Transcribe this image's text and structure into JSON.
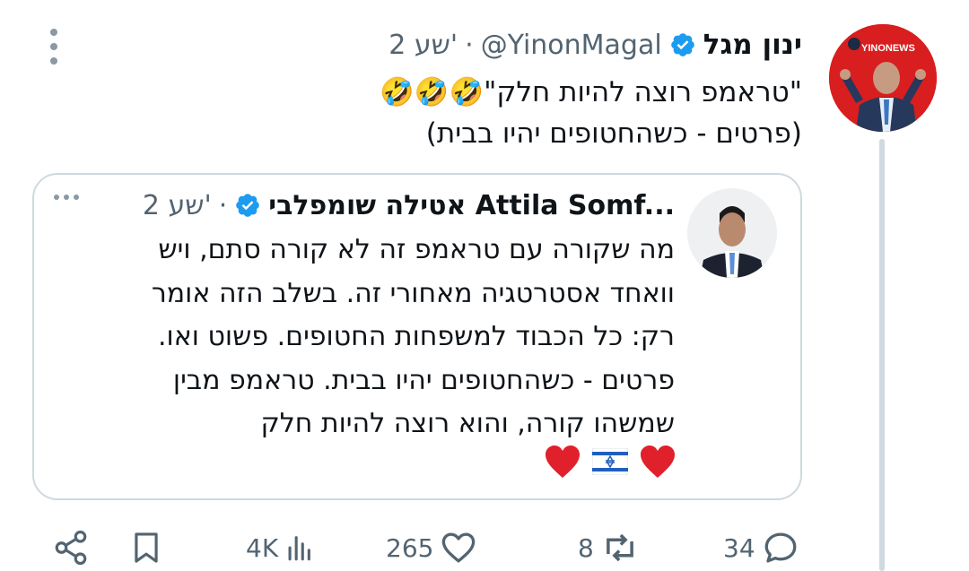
{
  "post": {
    "author_name": "ינון מגל",
    "handle": "@YinonMagal",
    "separator": "·",
    "time": "2 שע'",
    "verified": true,
    "avatar_badge": "YINONEWS",
    "text_lines": [
      "\"טראמפ רוצה להיות חלק\"🤣🤣🤣",
      "(פרטים - כשהחטופים יהיו בבית)"
    ]
  },
  "quote": {
    "author_name": "אטילה שומפלבי Attila Somf...",
    "separator": "·",
    "time": "2 שע'",
    "verified": true,
    "text_lines": [
      "מה שקורה עם טראמפ זה לא קורה סתם, ויש",
      "וואחד אסטרטגיה מאחורי זה. בשלב הזה אומר",
      "רק: כל הכבוד למשפחות החטופים. פשוט ואו.",
      "פרטים - כשהחטופים יהיו בבית. טראמפ מבין",
      "שמשהו קורה, והוא רוצה להיות חלק"
    ],
    "emojis": [
      "❤️",
      "🇮🇱",
      "❤️"
    ]
  },
  "actions": {
    "replies": "34",
    "reposts": "8",
    "likes": "265",
    "views": "4K"
  },
  "icons": [
    "more-vertical-icon",
    "verified-badge-icon",
    "more-horizontal-icon",
    "reply-icon",
    "repost-icon",
    "like-icon",
    "views-icon",
    "bookmark-icon",
    "share-icon"
  ],
  "colors": {
    "verified": "#1d9bf0",
    "secondary_text": "#536471",
    "thread_line": "#cfd9de",
    "avatar_bg": "#d81e1e"
  }
}
